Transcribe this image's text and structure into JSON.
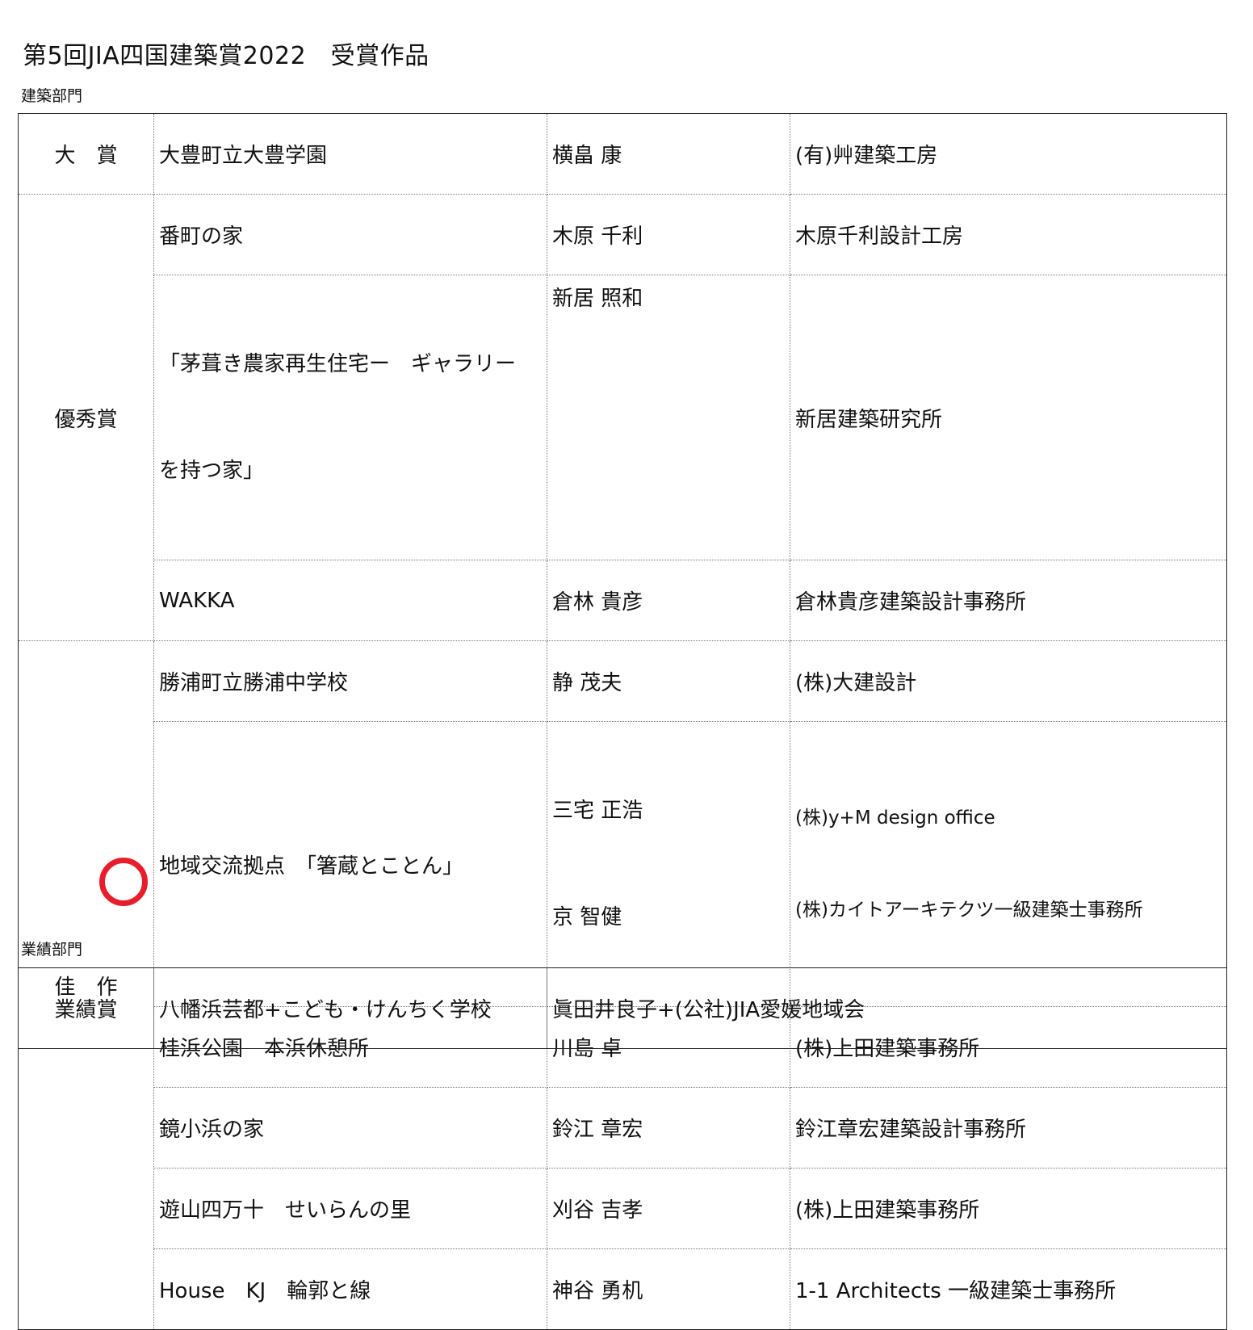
{
  "title": "第5回JIA四国建築賞2022　受賞作品",
  "sections": {
    "architecture_label": "建築部門",
    "achievement_label": "業績部門"
  },
  "awards": {
    "grand": {
      "category": "大　賞",
      "work": "大豊町立大豊学園",
      "architect": "横畠 康",
      "firm": "(有)艸建築工房"
    },
    "excellence": {
      "category": "優秀賞",
      "rows": [
        {
          "work": "番町の家",
          "architect": "木原 千利",
          "firm": "木原千利設計工房"
        },
        {
          "work_line1": "「茅葺き農家再生住宅ー　ギャラリー",
          "work_line2": "を持つ家」",
          "architect": "新居 照和",
          "firm": "新居建築研究所"
        },
        {
          "work": "WAKKA",
          "architect": "倉林 貴彦",
          "firm": "倉林貴彦建築設計事務所"
        }
      ]
    },
    "merit": {
      "category": "佳　作",
      "rows": [
        {
          "work": "勝浦町立勝浦中学校",
          "architect": "静 茂夫",
          "firm": "(株)大建設計"
        },
        {
          "work": "地域交流拠点　「箸蔵とことん」",
          "architect_line1": "三宅 正浩",
          "architect_line2": "京 智健",
          "firm_line1": "(株)y+M design office",
          "firm_line2": "(株)カイトアーキテクツ一級建築士事務所"
        },
        {
          "work": "桂浜公園　本浜休憩所",
          "architect": "川島 卓",
          "firm": "(株)上田建築事務所"
        },
        {
          "work": "鏡小浜の家",
          "architect": "鈴江 章宏",
          "firm": "鈴江章宏建築設計事務所"
        },
        {
          "work": "遊山四万十　せいらんの里",
          "architect": "刈谷 吉孝",
          "firm": "(株)上田建築事務所"
        },
        {
          "work": "House　KJ　輪郭と線",
          "architect": "神谷 勇机",
          "firm": "1-1 Architects 一級建築士事務所"
        }
      ]
    }
  },
  "achievement": {
    "category": "業績賞",
    "work": "八幡浜芸都+こども・けんちく学校",
    "recipient": "眞田井良子+(公社)JIA愛媛地域会"
  },
  "marker": {
    "color": "#e81d2c"
  }
}
